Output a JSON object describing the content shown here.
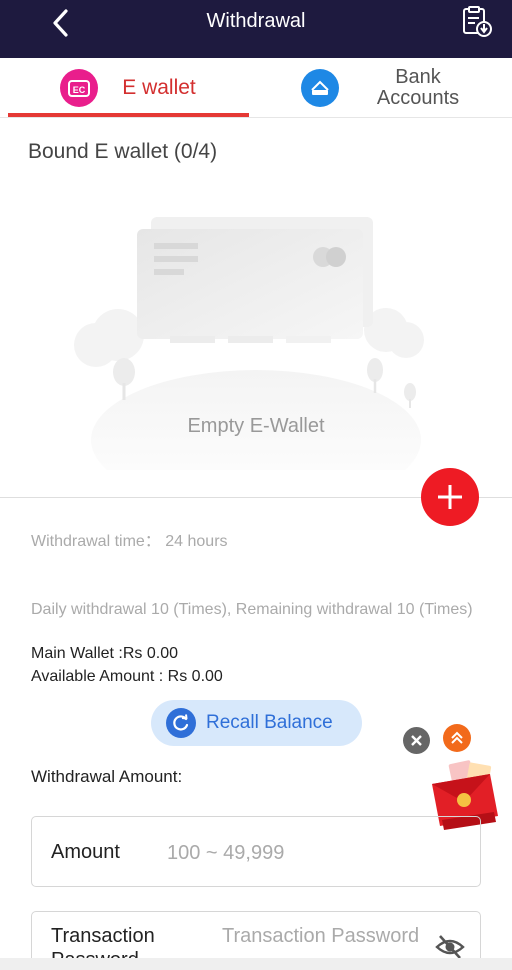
{
  "header": {
    "title": "Withdrawal",
    "back_icon": "chevron-left-icon",
    "record_icon": "clipboard-download-icon",
    "bg_color": "#1e1a3f"
  },
  "tabs": [
    {
      "label": "E wallet",
      "icon": "ewallet-icon",
      "active": true,
      "icon_color": "#e91e8c"
    },
    {
      "label": "Bank Accounts",
      "icon": "bank-card-icon",
      "active": false,
      "icon_color": "#1e88e5"
    }
  ],
  "bound": {
    "title": "Bound E wallet (0/4)"
  },
  "empty_state": {
    "label": "Empty E-Wallet"
  },
  "add_button": {
    "icon": "plus-icon",
    "color": "#ee1b24"
  },
  "info": {
    "withdrawal_time": "Withdrawal time： 24 hours",
    "daily_limit": "Daily withdrawal 10 (Times), Remaining withdrawal 10 (Times)",
    "main_wallet": "Main Wallet :Rs 0.00",
    "available_amount": "Available Amount : Rs 0.00"
  },
  "recall": {
    "label": "Recall Balance",
    "icon": "refresh-icon"
  },
  "floating": {
    "close_icon": "close-icon",
    "up_icon": "double-chevron-up-icon",
    "gift_icon": "red-envelope-gift-icon"
  },
  "form": {
    "withdrawal_amount_label": "Withdrawal Amount:",
    "amount_label": "Amount",
    "amount_placeholder": "100 ~ 49,999",
    "password_label": "Transaction Password",
    "password_placeholder": "Transaction Password",
    "eye_icon": "eye-off-icon"
  }
}
